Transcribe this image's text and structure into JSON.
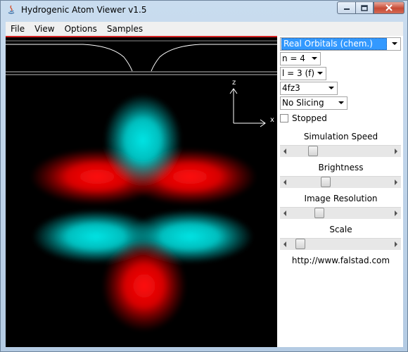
{
  "window": {
    "title": "Hydrogenic Atom Viewer v1.5"
  },
  "menu": [
    "File",
    "View",
    "Options",
    "Samples"
  ],
  "axes": {
    "z_label": "z",
    "x_label": "x"
  },
  "controls": {
    "view_mode": "Real Orbitals (chem.)",
    "n": "n = 4",
    "l": "l = 3 (f)",
    "orbital": "4fz3",
    "slicing": "No Slicing",
    "stopped_label": "Stopped",
    "stopped_checked": false
  },
  "sliders": [
    {
      "label": "Simulation Speed",
      "value": 0.2
    },
    {
      "label": "Brightness",
      "value": 0.34
    },
    {
      "label": "Image Resolution",
      "value": 0.27
    },
    {
      "label": "Scale",
      "value": 0.06
    }
  ],
  "url": "http://www.falstad.com",
  "colors": {
    "positive_lobe": "#00e5e5",
    "negative_lobe": "#ff0000",
    "selection": "#3399ff"
  }
}
